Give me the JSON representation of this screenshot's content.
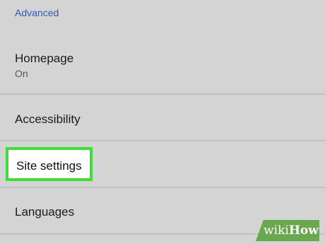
{
  "settings": {
    "section_header": "Advanced",
    "items": [
      {
        "title": "Homepage",
        "subtitle": "On"
      },
      {
        "title": "Accessibility"
      },
      {
        "title": "Site settings"
      },
      {
        "title": "Languages"
      }
    ]
  },
  "watermark": {
    "part1": "wiki",
    "part2": "How"
  },
  "colors": {
    "background": "#d4d4d4",
    "section_header": "#2c5bb3",
    "highlight_border": "#3fdc3a",
    "divider": "#c2c2c2"
  }
}
